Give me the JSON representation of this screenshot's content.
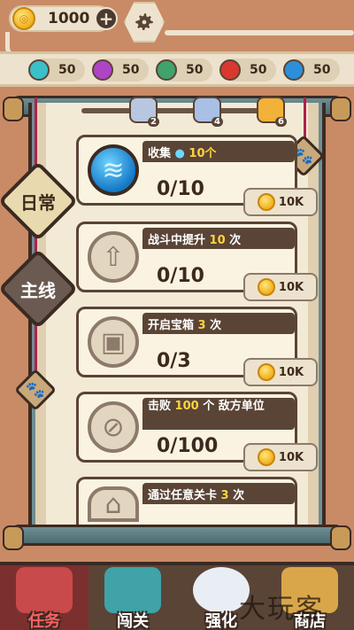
{
  "currency": {
    "coins": "1000"
  },
  "essences": [
    {
      "name": "water-essence",
      "value": "50",
      "color": "#3bbfc9"
    },
    {
      "name": "poison-essence",
      "value": "50",
      "color": "#b044c7"
    },
    {
      "name": "nature-essence",
      "value": "50",
      "color": "#3fa36b"
    },
    {
      "name": "fire-essence",
      "value": "50",
      "color": "#d9382f"
    },
    {
      "name": "ice-essence",
      "value": "50",
      "color": "#2d8fd9"
    }
  ],
  "chests": [
    {
      "count": "2",
      "color": "#b7c7e0"
    },
    {
      "count": "4",
      "color": "#a8bfe6"
    },
    {
      "count": "6",
      "color": "#f2b23a"
    }
  ],
  "tabs": {
    "daily": "日常",
    "main": "主线"
  },
  "quests": [
    {
      "title_pre": "收集",
      "title_hl": "10个",
      "title_post": "",
      "progress": "0/10",
      "reward": "10K",
      "icon": "water-drop-icon"
    },
    {
      "title_pre": "战斗中提升",
      "title_hl": "10",
      "title_post": "次",
      "progress": "0/10",
      "reward": "10K",
      "icon": "upgrade-arrow-icon"
    },
    {
      "title_pre": "开启宝箱",
      "title_hl": "3",
      "title_post": "次",
      "progress": "0/3",
      "reward": "10K",
      "icon": "treasure-chest-icon"
    },
    {
      "title_pre": "击败",
      "title_hl": "100",
      "title_post": "个 敌方单位",
      "progress": "0/100",
      "reward": "10K",
      "icon": "enemy-cat-icon"
    },
    {
      "title_pre": "通过任意关卡",
      "title_hl": "3",
      "title_post": "次",
      "progress": "",
      "reward": "",
      "icon": "level-gate-icon"
    }
  ],
  "nav": [
    {
      "label": "任务"
    },
    {
      "label": "闯关"
    },
    {
      "label": "强化"
    },
    {
      "label": "商店"
    }
  ],
  "watermark": "大玩客",
  "colors": {
    "accent_red": "#b0214a",
    "panel_teal": "#6f8e93",
    "dark_brown": "#5a4436"
  }
}
